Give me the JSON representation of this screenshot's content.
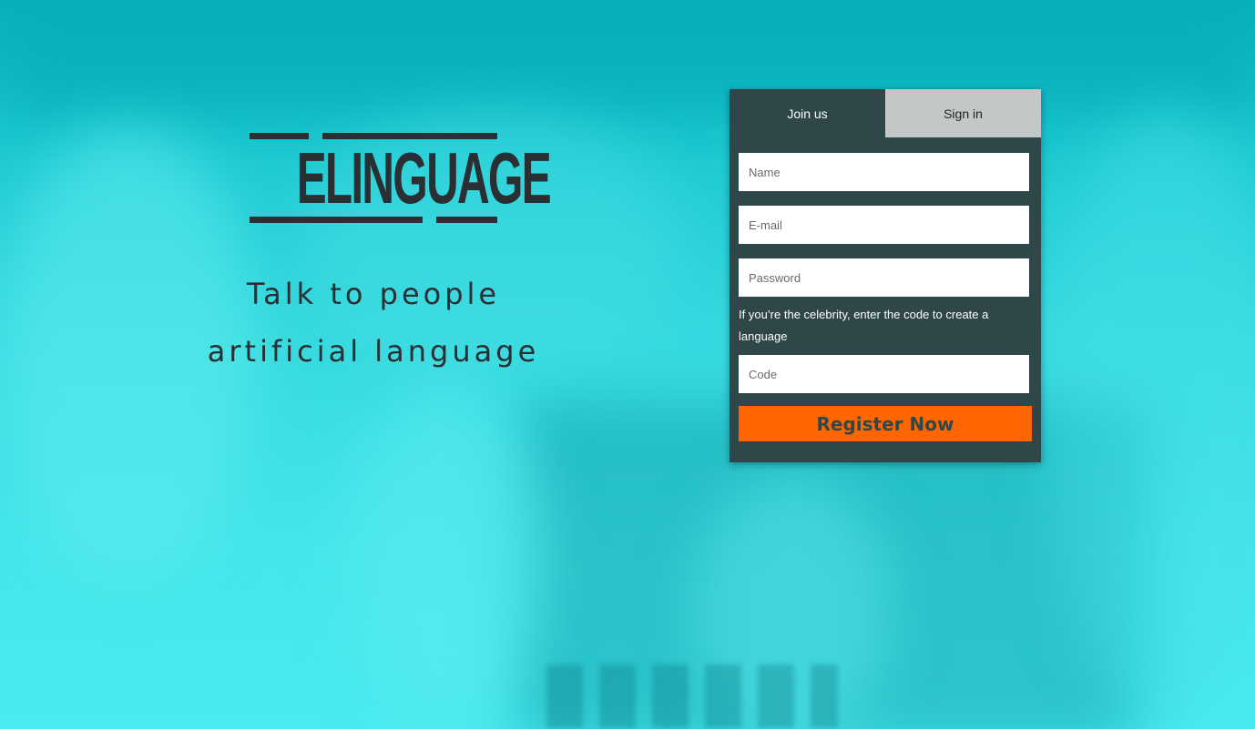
{
  "brand": {
    "logo_text": "ELINGUAGE",
    "tagline_line1": "Talk to people",
    "tagline_line2": "artificial language"
  },
  "auth": {
    "tabs": [
      {
        "label": "Join us",
        "active": true
      },
      {
        "label": "Sign in",
        "active": false
      }
    ],
    "fields": {
      "name_placeholder": "Name",
      "email_placeholder": "E-mail",
      "password_placeholder": "Password",
      "code_placeholder": "Code"
    },
    "hint": "If you’re the celebrity, enter the code to create a language",
    "register_label": "Register Now"
  },
  "colors": {
    "panel": "#30474a",
    "accent": "#ff6600",
    "inactive_tab": "#c3c7c8",
    "background": "#3fe3e6",
    "text_dark": "#2a2f33"
  }
}
